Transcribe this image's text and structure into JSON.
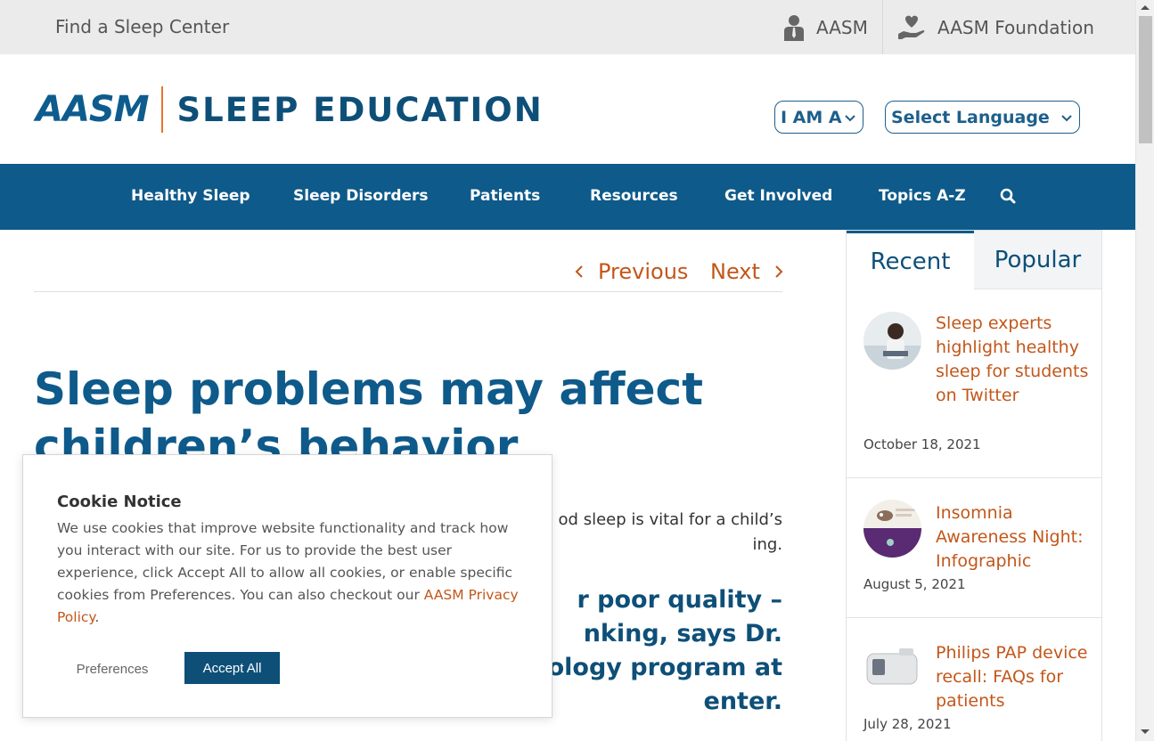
{
  "topbar": {
    "find_center": "Find a Sleep Center",
    "aasm_link": "AASM",
    "foundation_link": "AASM Foundation"
  },
  "header": {
    "logo_mark": "AASM",
    "logo_text": "SLEEP EDUCATION",
    "iam_select": "I AM A",
    "language_select": "Select Language"
  },
  "nav": {
    "items": [
      "Healthy Sleep",
      "Sleep Disorders",
      "Patients",
      "Resources",
      "Get Involved",
      "Topics A-Z"
    ]
  },
  "article": {
    "previous": "Previous",
    "next": "Next",
    "title_line1": "Sleep problems may affect",
    "title_line2": "children’s behavior",
    "para_line1": "od sleep is vital for a child’s",
    "para_line2": "ing.",
    "lead_line1": "r poor quality –",
    "lead_line2": "nking, says Dr.",
    "lead_line3": "ology program at",
    "lead_line4": "enter."
  },
  "sidebar": {
    "tab_recent": "Recent",
    "tab_popular": "Popular",
    "posts": [
      {
        "title": "Sleep experts highlight healthy sleep for students on Twitter",
        "date": "October 18, 2021"
      },
      {
        "title": "Insomnia Awareness Night: Infographic",
        "date": "August 5, 2021"
      },
      {
        "title": "Philips PAP device recall: FAQs for patients",
        "date": "July 28, 2021"
      }
    ]
  },
  "cookie": {
    "heading": "Cookie Notice",
    "body": "We use cookies that improve website functionality and track how you interact with our site. For us to provide the best user experience, click Accept All to allow all cookies, or enable specific cookies from Preferences. You can also checkout our ",
    "link": "AASM Privacy Policy",
    "period": ".",
    "preferences": "Preferences",
    "accept": "Accept All"
  },
  "colors": {
    "brand_blue": "#0e5a8a",
    "accent_orange": "#c2571a"
  }
}
